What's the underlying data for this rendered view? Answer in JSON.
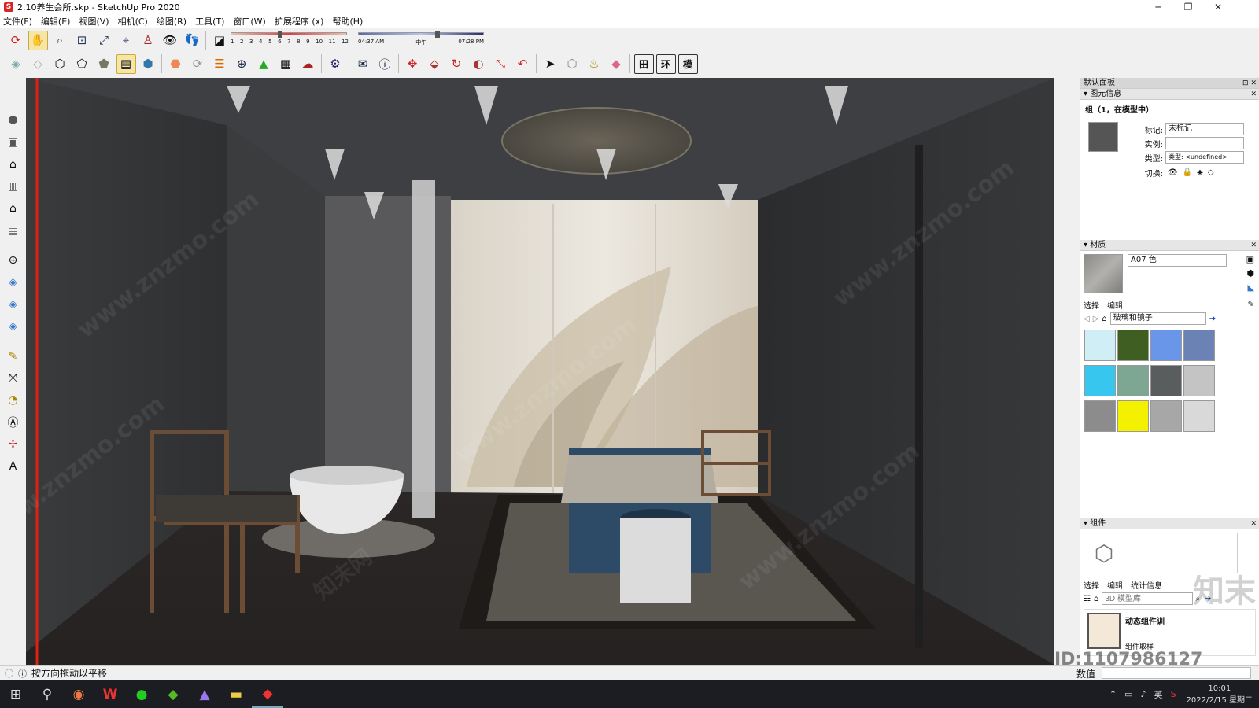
{
  "titlebar": {
    "title": "2.10养生会所.skp - SketchUp Pro 2020",
    "minimize": "─",
    "maximize": "❐",
    "close": "✕"
  },
  "menu": [
    "文件(F)",
    "编辑(E)",
    "视图(V)",
    "相机(C)",
    "绘图(R)",
    "工具(T)",
    "窗口(W)",
    "扩展程序 (x)",
    "帮助(H)"
  ],
  "shadow": {
    "months": [
      "1",
      "2",
      "3",
      "4",
      "5",
      "6",
      "7",
      "8",
      "9",
      "10",
      "11",
      "12"
    ],
    "time_start": "04:37 AM",
    "time_mid": "中午",
    "time_end": "07:28 PM"
  },
  "toolbar_bottom": {
    "btn_table": "田",
    "btn_env": "环",
    "btn_model": "模"
  },
  "panel": {
    "title": "默认面板",
    "entity": {
      "header": "图元信息",
      "name": "组（1，在模型中）",
      "tag_label": "标记:",
      "tag_value": "未标记",
      "instance_label": "实例:",
      "instance_value": "",
      "type_label": "类型:",
      "type_value": "类型: <undefined>",
      "toggle_label": "切换:"
    },
    "material": {
      "header": "材质",
      "name": "A07 色",
      "tab_select": "选择",
      "tab_edit": "编辑",
      "library": "玻璃和镜子",
      "swatch_colors": [
        "#cfeef5",
        "#3f5e22",
        "#6a96ea",
        "#6b82b5",
        "#36c6ee",
        "#7da793",
        "#595d5e",
        "#c4c4c4",
        "#8c8c8c",
        "#f3f000",
        "#a7a7a7",
        "#d9d9d9"
      ]
    },
    "components": {
      "header": "组件",
      "tab_select": "选择",
      "tab_edit": "编辑",
      "tab_stats": "统计信息",
      "search_placeholder": "3D 模型库",
      "result_title": "动态组件训",
      "result_sub": "组件取样"
    }
  },
  "status": {
    "text": "按方向拖动以平移",
    "measure_label": "数值"
  },
  "taskbar": {
    "ime": "英",
    "time": "10:01",
    "date": "2022/2/15 星期二"
  },
  "watermark": {
    "text": "www.znzmo.com",
    "brand": "知末网",
    "brand_logo": "知末",
    "id": "ID:1107986127"
  }
}
